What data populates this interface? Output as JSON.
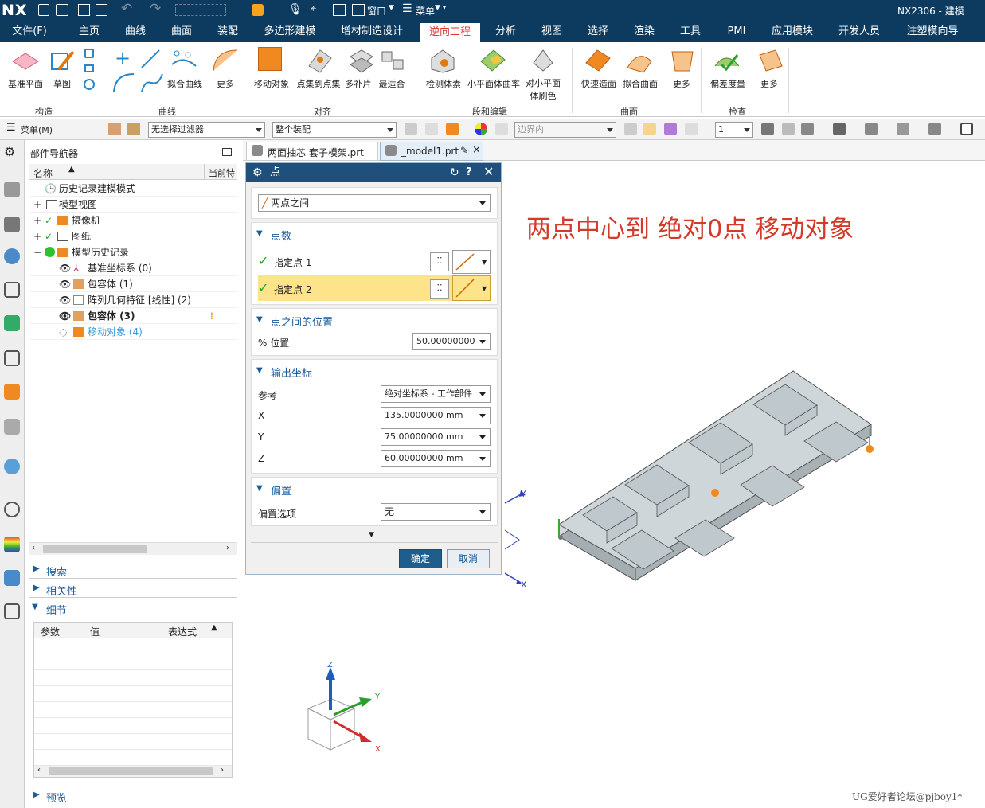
{
  "titlebar": {
    "logo": "NX",
    "window_label": "窗口",
    "menu_label": "菜单",
    "title": "NX2306 - 建模"
  },
  "ribbon_tabs": [
    "文件(F)",
    "主页",
    "曲线",
    "曲面",
    "装配",
    "多边形建模",
    "增材制造设计",
    "逆向工程",
    "分析",
    "视图",
    "选择",
    "渲染",
    "工具",
    "PMI",
    "应用模块",
    "开发人员",
    "注塑模向导"
  ],
  "ribbon": {
    "buttons": [
      "基准平面",
      "草图",
      "拟合曲线",
      "更多",
      "移动对象",
      "点集到点集",
      "多补片",
      "最适合",
      "检测体素",
      "小平面体曲率",
      "对小平面\n体刷色",
      "快速造面",
      "拟合曲面",
      "更多",
      "偏差度量",
      "更多"
    ],
    "groups": [
      "构造",
      "曲线",
      "对齐",
      "段和编辑",
      "曲面",
      "检查"
    ]
  },
  "toolbar2": {
    "menu_label": "菜单(M)",
    "filter_value": "无选择过滤器",
    "assembly_value": "整个装配",
    "boundary_value": "边界内",
    "number_value": "1"
  },
  "navigator": {
    "title": "部件导航器",
    "col_name": "名称",
    "col_current": "当前特",
    "rows": [
      {
        "label": "历史记录建模模式"
      },
      {
        "label": "模型视图"
      },
      {
        "label": "摄像机"
      },
      {
        "label": "图纸"
      },
      {
        "label": "模型历史记录"
      },
      {
        "label": "基准坐标系 (0)"
      },
      {
        "label": "包容体 (1)"
      },
      {
        "label": "阵列几何特征 [线性] (2)"
      },
      {
        "label": "包容体 (3)"
      },
      {
        "label": "移动对象 (4)"
      }
    ],
    "sections": {
      "search": "搜索",
      "relevance": "相关性",
      "details": "细节",
      "preview": "预览"
    },
    "details_cols": [
      "参数",
      "值",
      "表达式"
    ]
  },
  "doc_tabs": [
    {
      "label": "两面抽芯 套子模架.prt"
    },
    {
      "label": "_model1.prt"
    }
  ],
  "dialog": {
    "title": "点",
    "type_value": "两点之间",
    "sec_points": "点数",
    "point1": "指定点 1",
    "point2": "指定点 2",
    "sec_position": "点之间的位置",
    "position_label": "% 位置",
    "position_value": "50.00000000",
    "sec_output": "输出坐标",
    "reference_label": "参考",
    "reference_value": "绝对坐标系 - 工作部件",
    "x_label": "X",
    "x_value": "135.0000000",
    "y_label": "Y",
    "y_value": "75.00000000",
    "z_label": "Z",
    "z_value": "60.00000000",
    "unit": "mm",
    "sec_offset": "偏置",
    "offset_label": "偏置选项",
    "offset_value": "无",
    "ok": "确定",
    "cancel": "取消"
  },
  "viewport": {
    "annotation": "两点中心到 绝对0点 移动对象",
    "axis_x": "X",
    "axis_y": "Y",
    "axis_z": "Z",
    "watermark": "UG爱好者论坛@pjboy1*"
  },
  "colors": {
    "brand": "#0d3b5f",
    "accent": "#d33a2a",
    "highlight": "#fde38a",
    "dialog_header": "#1f4f7b"
  }
}
